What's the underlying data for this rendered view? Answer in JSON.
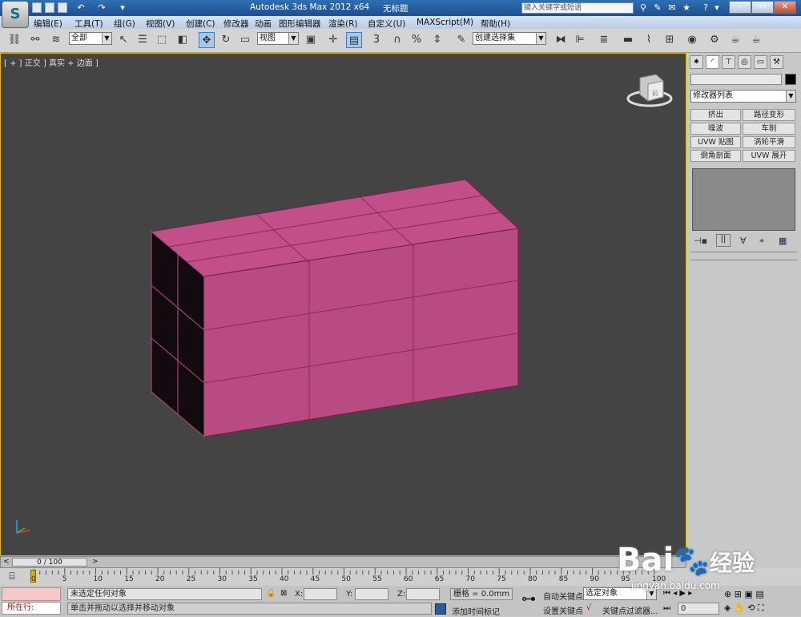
{
  "window": {
    "app_title": "Autodesk 3ds Max  2012 x64",
    "doc_title": "无标题",
    "search_placeholder": "键入关键字或短语",
    "logo_glyph": "S"
  },
  "menu": [
    "编辑(E)",
    "工具(T)",
    "组(G)",
    "视图(V)",
    "创建(C)",
    "修改器",
    "动画",
    "图形编辑器",
    "渲染(R)",
    "自定义(U)",
    "MAXScript(M)",
    "帮助(H)"
  ],
  "toolbar": {
    "selection_filter": "全部",
    "ref_coord": "视图",
    "named_selection": "创建选择集",
    "scale_label": "%"
  },
  "viewport": {
    "label": "[ + ] 正交 ] 真实 + 边面 ]",
    "viewcube_label": "前",
    "box_color": "#b84c82",
    "box_dark": "#130a0f"
  },
  "command_panel": {
    "modifier_list": "修改器列表",
    "modifier_buttons": [
      "挤出",
      "路径变形",
      "噪波",
      "车削",
      "UVW 贴图",
      "涡轮平滑",
      "倒角剖面",
      "UVW 展开"
    ]
  },
  "timeline": {
    "frame_display": "0 / 100",
    "ticks": [
      "0",
      "5",
      "10",
      "15",
      "20",
      "25",
      "30",
      "35",
      "40",
      "45",
      "50",
      "55",
      "60",
      "65",
      "70",
      "75",
      "80",
      "85",
      "90",
      "95",
      "100"
    ]
  },
  "status": {
    "running": "所在行:",
    "selection_status": "未选定任何对象",
    "prompt": "单击并拖动以选择并移动对象",
    "x_label": "X:",
    "y_label": "Y:",
    "z_label": "Z:",
    "grid": "栅格 = 0.0mm",
    "add_time_tag": "添加时间标记",
    "auto_key": "自动关键点",
    "set_key": "设置关键点",
    "key_mode": "选定对象",
    "key_filters": "关键点过滤器...",
    "current_frame": "0"
  },
  "watermark": {
    "brand": "Bai",
    "brand_cn": "经验",
    "url": "jingyan.baidu.com"
  }
}
